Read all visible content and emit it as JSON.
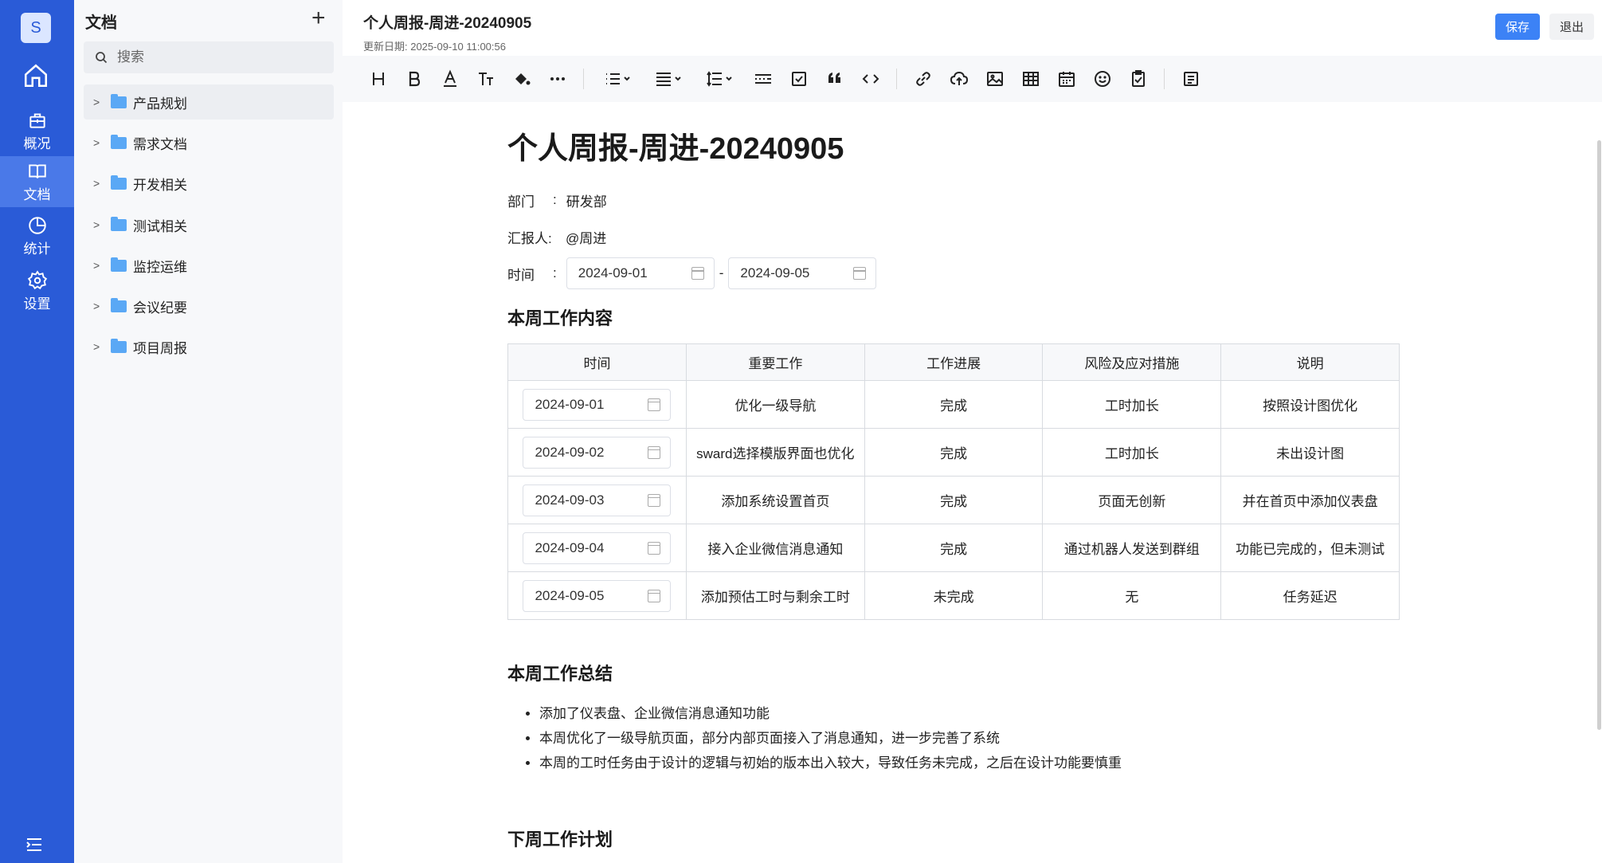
{
  "rail": {
    "avatar": "S",
    "items": [
      {
        "label": "概况"
      },
      {
        "label": "文档"
      },
      {
        "label": "统计"
      },
      {
        "label": "设置"
      }
    ]
  },
  "tree": {
    "title": "文档",
    "search_placeholder": "搜索",
    "folders": [
      "产品规划",
      "需求文档",
      "开发相关",
      "测试相关",
      "监控运维",
      "会议纪要",
      "项目周报"
    ]
  },
  "header": {
    "title": "个人周报-周进-20240905",
    "updated": "更新日期: 2025-09-10 11:00:56",
    "save_label": "保存",
    "exit_label": "退出"
  },
  "doc": {
    "heading": "个人周报-周进-20240905",
    "department_label": "部门",
    "department_value": "研发部",
    "reporter_label": "汇报人:",
    "reporter_value": "@周进",
    "time_label": "时间",
    "date_from": "2024-09-01",
    "date_to": "2024-09-05",
    "range_sep": "-",
    "section_work": "本周工作内容",
    "table": {
      "headers": [
        "时间",
        "重要工作",
        "工作进展",
        "风险及应对措施",
        "说明"
      ],
      "rows": [
        [
          "2024-09-01",
          "优化一级导航",
          "完成",
          "工时加长",
          "按照设计图优化"
        ],
        [
          "2024-09-02",
          "sward选择模版界面也优化",
          "完成",
          "工时加长",
          "未出设计图"
        ],
        [
          "2024-09-03",
          "添加系统设置首页",
          "完成",
          "页面无创新",
          "并在首页中添加仪表盘"
        ],
        [
          "2024-09-04",
          "接入企业微信消息通知",
          "完成",
          "通过机器人发送到群组",
          "功能已完成的，但未测试"
        ],
        [
          "2024-09-05",
          "添加预估工时与剩余工时",
          "未完成",
          "无",
          "任务延迟"
        ]
      ]
    },
    "section_summary": "本周工作总结",
    "summary_items": [
      "添加了仪表盘、企业微信消息通知功能",
      "本周优化了一级导航页面，部分内部页面接入了消息通知，进一步完善了系统",
      "本周的工时任务由于设计的逻辑与初始的版本出入较大，导致任务未完成，之后在设计功能要慎重"
    ],
    "section_next": "下周工作计划"
  },
  "colors": {
    "rail_bg": "#2a5bd7",
    "rail_active": "#4a79e8",
    "primary_button": "#3c82f6",
    "folder": "#5aa8f5"
  },
  "toolbar_icons": [
    "heading-icon",
    "bold-icon",
    "font-color-icon",
    "font-size-icon",
    "fill-color-icon",
    "more-icon",
    "bullet-list-icon",
    "align-icon",
    "line-height-icon",
    "divider-icon",
    "checkbox-icon",
    "quote-icon",
    "code-icon",
    "link-icon",
    "upload-icon",
    "image-icon",
    "table-icon",
    "calendar-icon",
    "emoji-icon",
    "clipboard-icon",
    "outline-icon"
  ]
}
